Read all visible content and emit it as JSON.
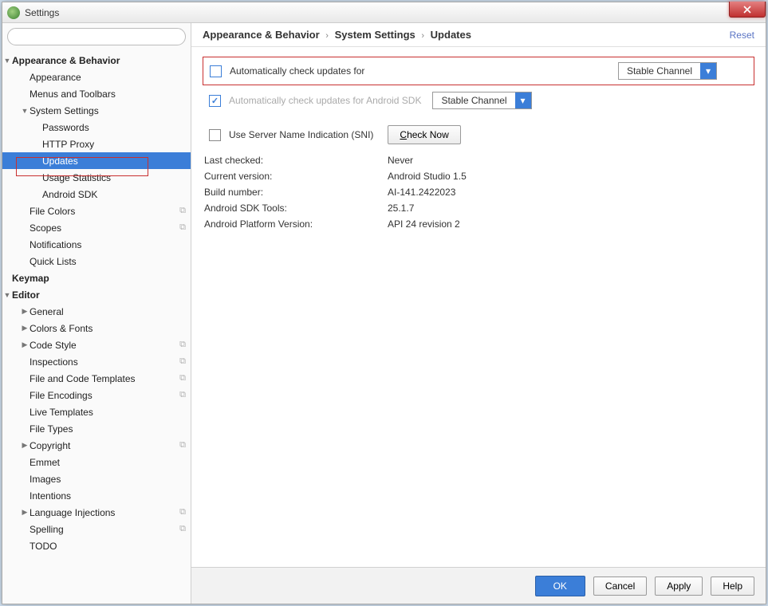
{
  "window": {
    "title": "Settings"
  },
  "search": {
    "placeholder": ""
  },
  "sidebar": {
    "items": [
      {
        "label": "Appearance & Behavior",
        "depth": 0,
        "arrow": "down",
        "bold": true
      },
      {
        "label": "Appearance",
        "depth": 1
      },
      {
        "label": "Menus and Toolbars",
        "depth": 1
      },
      {
        "label": "System Settings",
        "depth": 1,
        "arrow": "down"
      },
      {
        "label": "Passwords",
        "depth": 2
      },
      {
        "label": "HTTP Proxy",
        "depth": 2
      },
      {
        "label": "Updates",
        "depth": 2,
        "selected": true
      },
      {
        "label": "Usage Statistics",
        "depth": 2
      },
      {
        "label": "Android SDK",
        "depth": 2
      },
      {
        "label": "File Colors",
        "depth": 1,
        "copy": true
      },
      {
        "label": "Scopes",
        "depth": 1,
        "copy": true
      },
      {
        "label": "Notifications",
        "depth": 1
      },
      {
        "label": "Quick Lists",
        "depth": 1
      },
      {
        "label": "Keymap",
        "depth": 0,
        "bold": true
      },
      {
        "label": "Editor",
        "depth": 0,
        "arrow": "down",
        "bold": true
      },
      {
        "label": "General",
        "depth": 1,
        "arrow": "right"
      },
      {
        "label": "Colors & Fonts",
        "depth": 1,
        "arrow": "right"
      },
      {
        "label": "Code Style",
        "depth": 1,
        "arrow": "right",
        "copy": true
      },
      {
        "label": "Inspections",
        "depth": 1,
        "copy": true
      },
      {
        "label": "File and Code Templates",
        "depth": 1,
        "copy": true
      },
      {
        "label": "File Encodings",
        "depth": 1,
        "copy": true
      },
      {
        "label": "Live Templates",
        "depth": 1
      },
      {
        "label": "File Types",
        "depth": 1
      },
      {
        "label": "Copyright",
        "depth": 1,
        "arrow": "right",
        "copy": true
      },
      {
        "label": "Emmet",
        "depth": 1
      },
      {
        "label": "Images",
        "depth": 1
      },
      {
        "label": "Intentions",
        "depth": 1
      },
      {
        "label": "Language Injections",
        "depth": 1,
        "arrow": "right",
        "copy": true
      },
      {
        "label": "Spelling",
        "depth": 1,
        "copy": true
      },
      {
        "label": "TODO",
        "depth": 1
      }
    ]
  },
  "breadcrumb": [
    "Appearance & Behavior",
    "System Settings",
    "Updates"
  ],
  "reset": "Reset",
  "updates": {
    "auto_check_label": "Automatically check updates for",
    "auto_check_channel": "Stable Channel",
    "sdk_check_label": "Automatically check updates for Android SDK",
    "sdk_check_channel": "Stable Channel",
    "sni_label": "Use Server Name Indication (SNI)",
    "check_now": "Check Now",
    "info": [
      {
        "k": "Last checked:",
        "v": "Never"
      },
      {
        "k": "Current version:",
        "v": "Android Studio 1.5"
      },
      {
        "k": "Build number:",
        "v": "AI-141.2422023"
      },
      {
        "k": "Android SDK Tools:",
        "v": "25.1.7"
      },
      {
        "k": "Android Platform Version:",
        "v": "API 24 revision 2"
      }
    ]
  },
  "footer": {
    "ok": "OK",
    "cancel": "Cancel",
    "apply": "Apply",
    "help": "Help"
  }
}
